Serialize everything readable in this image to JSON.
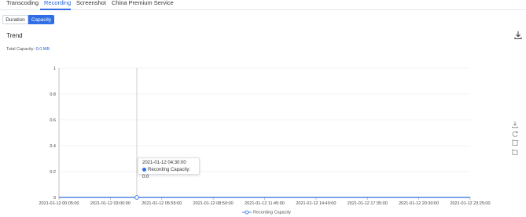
{
  "tabs": [
    {
      "label": "Transcoding",
      "active": false
    },
    {
      "label": "Recording",
      "active": true
    },
    {
      "label": "Screenshot",
      "active": false
    },
    {
      "label": "China Premium Service",
      "active": false
    }
  ],
  "segments": {
    "duration_label": "Duration",
    "capacity_label": "Capacity",
    "selected": "Capacity"
  },
  "section_title": "Trend",
  "total_capacity": {
    "label": "Total Capacity:",
    "value": "0.0 MB"
  },
  "icons": {
    "download": "download-icon",
    "save": "save-image-icon",
    "refresh": "restore-icon",
    "zoom": "data-zoom-icon",
    "back": "zoom-back-icon"
  },
  "tooltip": {
    "time": "2021-01-12 04:30:00",
    "series_label": "Recording Capacity:",
    "value": "0.0"
  },
  "colors": {
    "accent": "#2f6ee4",
    "series": "#2f6ee4",
    "grid": "#e5e7eb"
  },
  "chart_data": {
    "type": "line",
    "title": "",
    "xlabel": "",
    "ylabel": "",
    "ylim": [
      0,
      1
    ],
    "y_ticks": [
      "0",
      "0.2",
      "0.4",
      "0.6",
      "0.8",
      "1"
    ],
    "x_ticks": [
      "2021-01-12 00:05:00",
      "2021-01-12 03:00:00",
      "2021-01-12 05:55:00",
      "2021-01-12 08:50:00",
      "2021-01-12 11:45:00",
      "2021-01-12 14:40:00",
      "2021-01-12 17:35:00",
      "2021-01-12 20:30:00",
      "2021-01-12 23:25:00"
    ],
    "series": [
      {
        "name": "Recording Capacity",
        "x": [
          "2021-01-12 00:05:00",
          "2021-01-12 04:30:00",
          "2021-01-12 23:25:00"
        ],
        "values": [
          0.0,
          0.0,
          0.0
        ]
      }
    ],
    "highlighted_x": "2021-01-12 04:30:00",
    "grid": true,
    "legend": "bottom"
  }
}
